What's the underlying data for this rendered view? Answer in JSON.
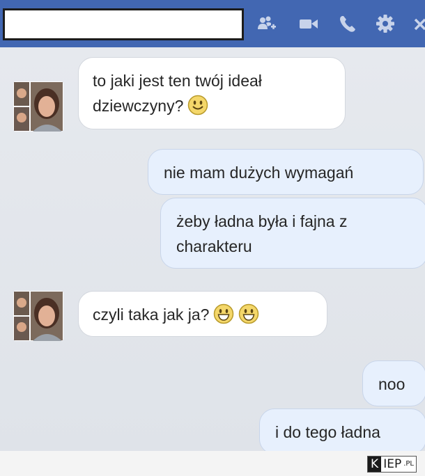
{
  "header": {
    "contact_name": "",
    "icons": [
      "add-people-icon",
      "video-call-icon",
      "phone-call-icon",
      "settings-gear-icon",
      "close-icon"
    ],
    "background_color": "#4267b2"
  },
  "messages": [
    {
      "side": "incoming",
      "lines": [
        "to jaki jest ten twój ideał",
        "dziewczyny?"
      ],
      "emoji_count": 1
    },
    {
      "side": "outgoing",
      "text": "nie mam dużych wymagań"
    },
    {
      "side": "outgoing",
      "lines": [
        "żeby ładna była i fajna z",
        "charakteru"
      ]
    },
    {
      "side": "incoming",
      "text": "czyli taka jak ja?",
      "emoji_count": 2
    },
    {
      "side": "outgoing",
      "text": "noo"
    },
    {
      "side": "outgoing",
      "text": "i do tego ładna"
    }
  ],
  "watermark": {
    "first": "K",
    "rest": "IEP",
    "suffix": ".PL"
  },
  "colors": {
    "incoming_bubble": "#ffffff",
    "outgoing_bubble": "#e7f0fd",
    "chat_background": "#e6e9ee"
  }
}
